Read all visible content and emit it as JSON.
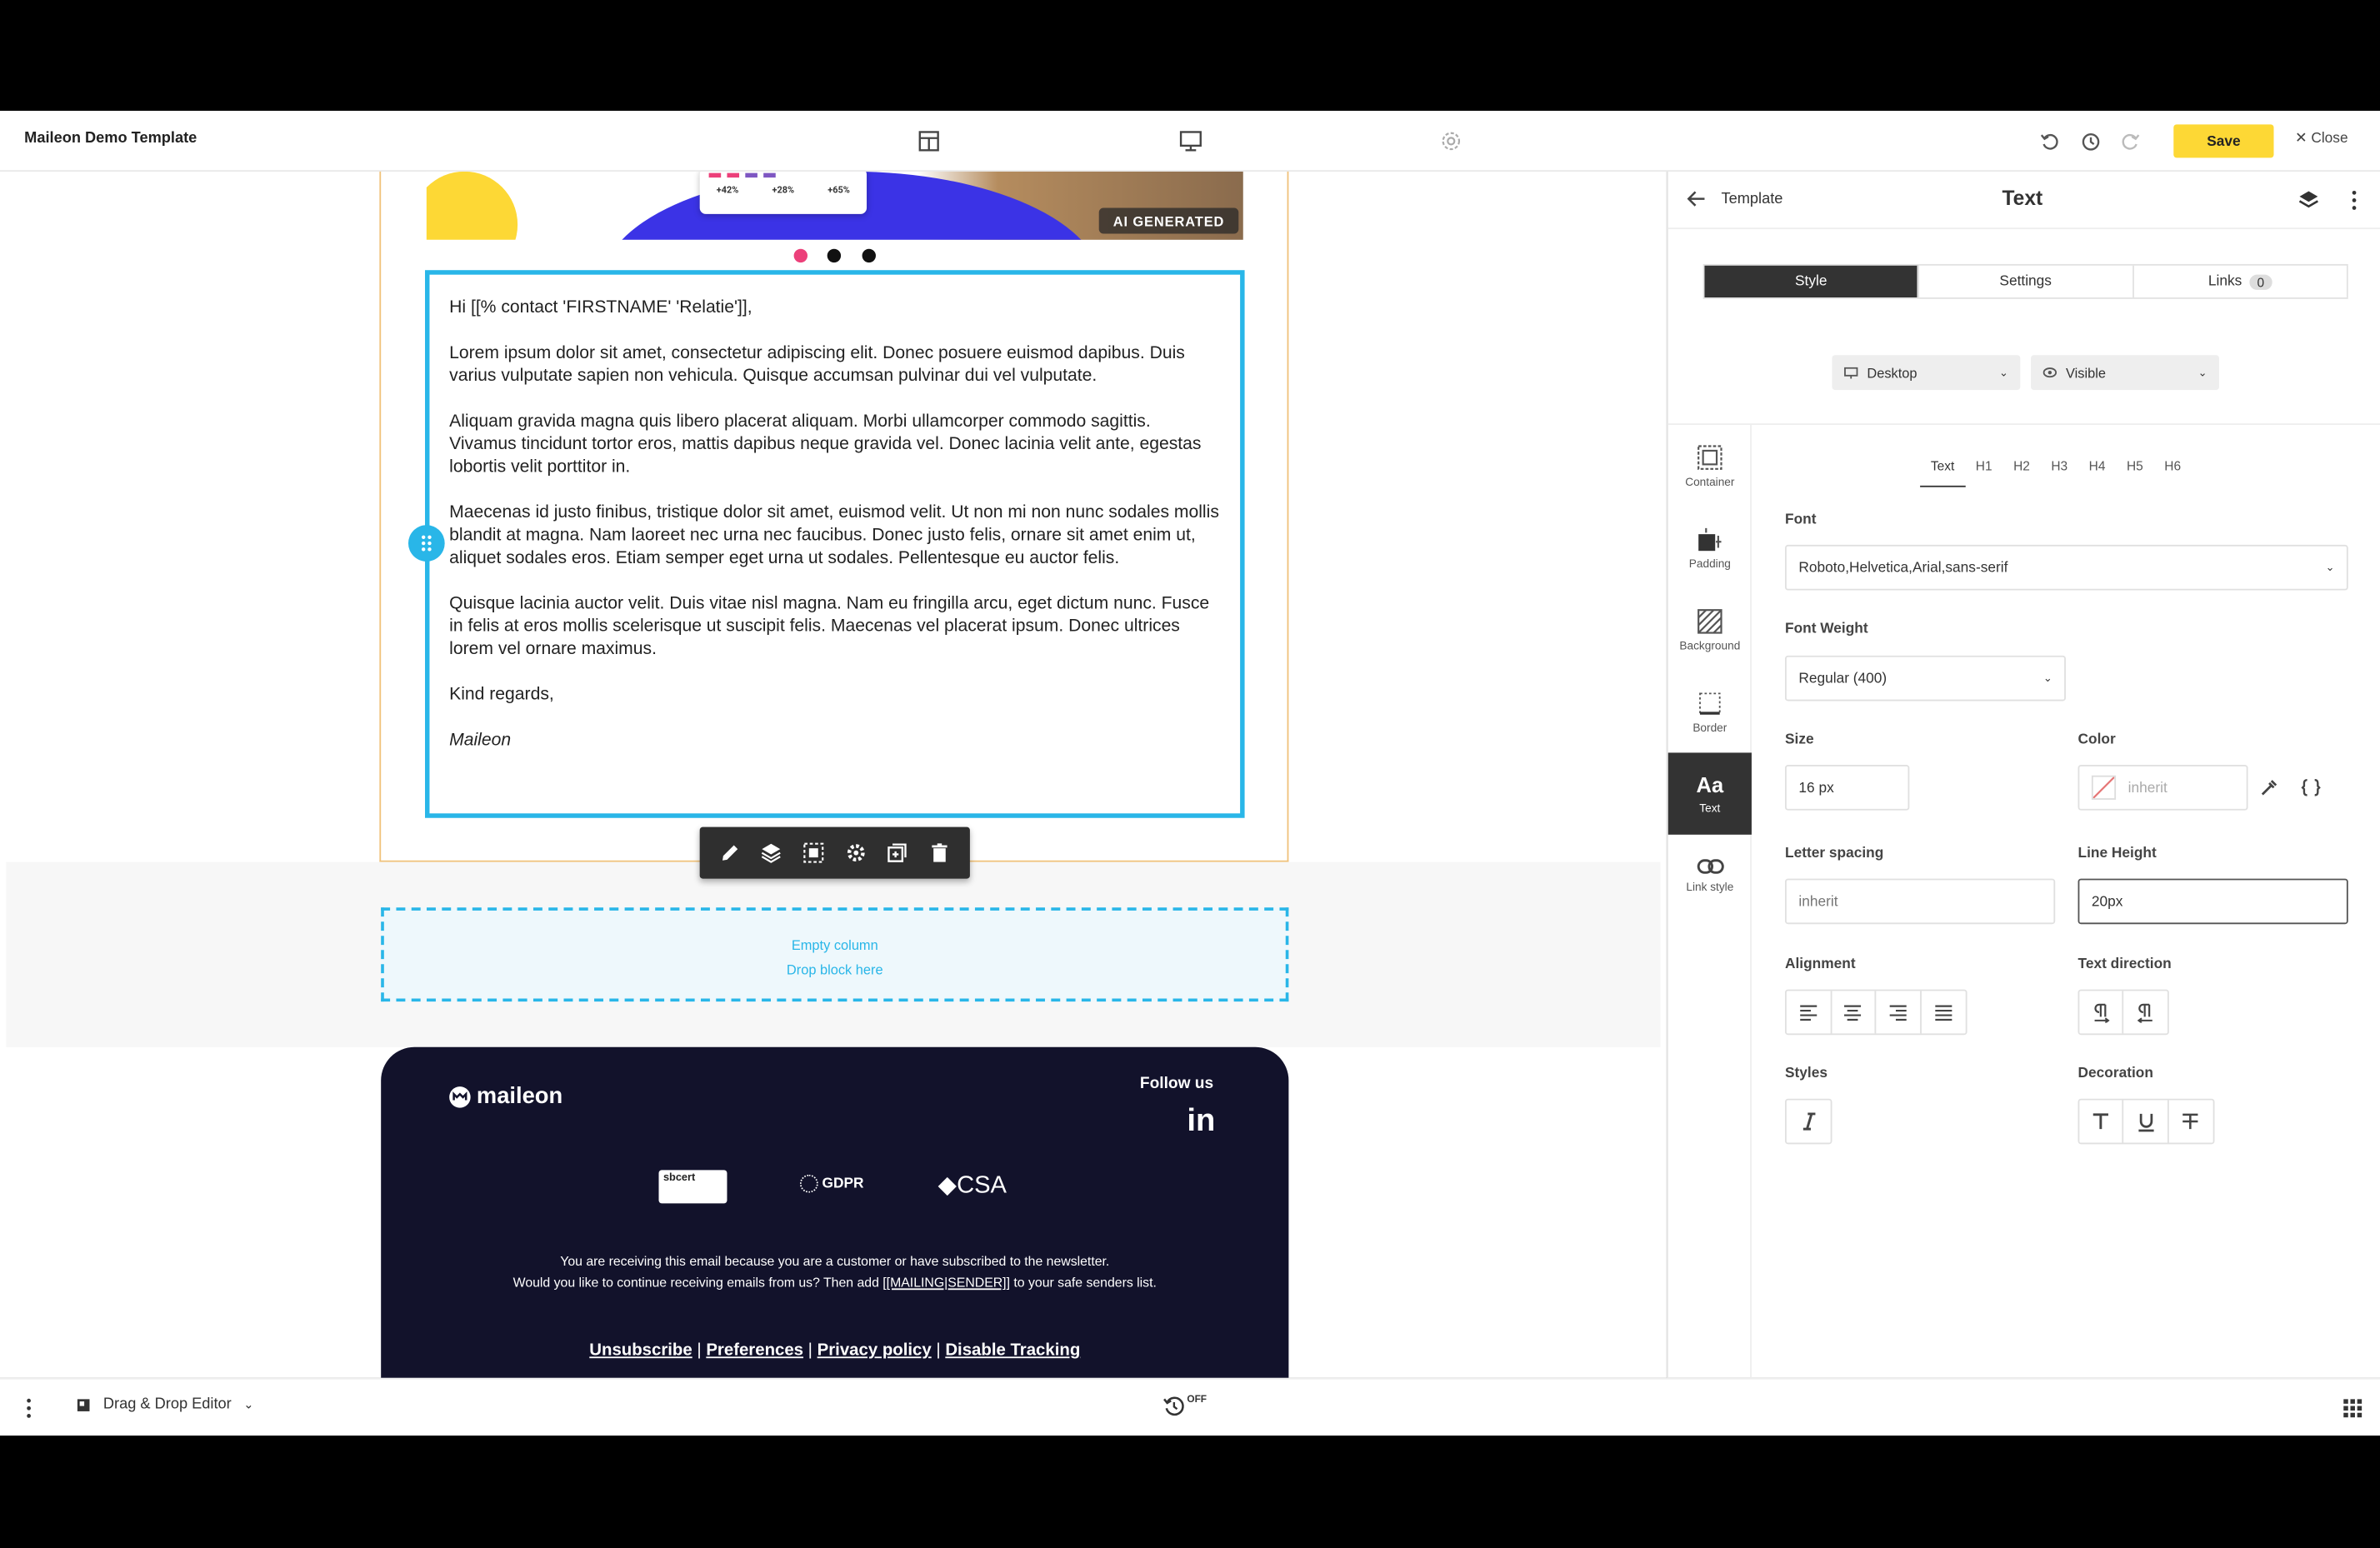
{
  "header": {
    "title": "Maileon Demo Template",
    "save_label": "Save",
    "close_label": "Close"
  },
  "canvas": {
    "hero": {
      "ai_badge": "AI GENERATED",
      "stats": [
        "+42%",
        "+28%",
        "+65%"
      ]
    },
    "text_block": {
      "paragraphs": [
        "Hi [[% contact 'FIRSTNAME' 'Relatie']],",
        "Lorem ipsum dolor sit amet, consectetur adipiscing elit. Donec posuere euismod dapibus. Duis varius vulputate sapien non vehicula. Quisque accumsan pulvinar dui vel vulputate.",
        "Aliquam gravida magna quis libero placerat aliquam. Morbi ullamcorper commodo sagittis. Vivamus tincidunt tortor eros, mattis dapibus neque gravida vel. Donec lacinia velit ante, egestas lobortis velit porttitor in.",
        " Maecenas id justo finibus, tristique dolor sit amet, euismod velit. Ut non mi non nunc sodales mollis blandit at magna. Nam laoreet nec urna nec faucibus. Donec justo felis, ornare sit amet enim ut, aliquet sodales eros. Etiam semper eget urna ut sodales. Pellentesque eu auctor felis.",
        "Quisque lacinia auctor velit. Duis vitae nisl magna. Nam eu fringilla arcu, eget dictum nunc. Fusce in felis at eros mollis scelerisque ut suscipit felis. Maecenas vel placerat ipsum. Donec ultrices lorem vel ornare maximus.",
        "Kind regards,",
        "Maileon"
      ]
    },
    "empty_column": {
      "line1": "Empty column",
      "line2": "Drop block here"
    },
    "footer": {
      "logo": "maileon",
      "follow_us": "Follow us",
      "linkedin": "in",
      "badge_sbcert": "sbcert",
      "badge_gdpr": "GDPR",
      "badge_csa": "CSA",
      "notice_line1": "You are receiving this email because you are a customer or have subscribed to the newsletter.",
      "notice_line2_prefix": "Would you like to continue receiving emails from us? Then add ",
      "notice_line2_token": "[[MAILING|SENDER]]",
      "notice_line2_suffix": " to your safe senders list.",
      "links": [
        "Unsubscribe",
        "Preferences",
        "Privacy policy",
        "Disable Tracking"
      ],
      "separator": " | "
    }
  },
  "panel": {
    "back_label": "Template",
    "title": "Text",
    "tabs": [
      {
        "label": "Style"
      },
      {
        "label": "Settings"
      },
      {
        "label": "Links",
        "count": "0"
      }
    ],
    "device_select": "Desktop",
    "visibility_select": "Visible",
    "rail": [
      {
        "label": "Container",
        "icon": "container-icon"
      },
      {
        "label": "Padding",
        "icon": "padding-icon"
      },
      {
        "label": "Background",
        "icon": "background-icon"
      },
      {
        "label": "Border",
        "icon": "border-icon"
      },
      {
        "label": "Text",
        "icon": "text-icon",
        "glyph": "Aa"
      },
      {
        "label": "Link style",
        "icon": "link-icon"
      }
    ],
    "heading_tabs": [
      "Text",
      "H1",
      "H2",
      "H3",
      "H4",
      "H5",
      "H6"
    ],
    "font_label": "Font",
    "font_value": "Roboto,Helvetica,Arial,sans-serif",
    "font_weight_label": "Font Weight",
    "font_weight_value": "Regular (400)",
    "size_label": "Size",
    "size_value": "16 px",
    "color_label": "Color",
    "color_value": "inherit",
    "letter_spacing_label": "Letter spacing",
    "letter_spacing_placeholder": "inherit",
    "line_height_label": "Line Height",
    "line_height_value": "20px",
    "alignment_label": "Alignment",
    "text_direction_label": "Text direction",
    "styles_label": "Styles",
    "decoration_label": "Decoration"
  },
  "bottombar": {
    "editor_mode": "Drag & Drop Editor",
    "autosave_state": "OFF"
  },
  "colors": {
    "accent": "#29b6e8",
    "save": "#fdd835",
    "footer_bg": "#12122b"
  }
}
